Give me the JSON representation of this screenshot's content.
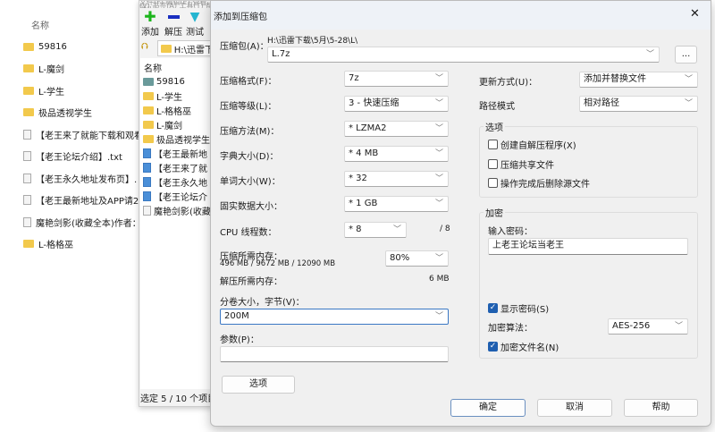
{
  "explorer": {
    "column_header": "名称",
    "items": [
      {
        "name": "59816",
        "type": "folder"
      },
      {
        "name": "L-魔剑",
        "type": "folder"
      },
      {
        "name": "L-学生",
        "type": "folder"
      },
      {
        "name": "极品透视学生",
        "type": "folder"
      },
      {
        "name": "【老王来了就能下载和观看",
        "type": "file"
      },
      {
        "name": "【老王论坛介绍】.txt",
        "type": "file"
      },
      {
        "name": "【老王永久地址发布页】.",
        "type": "file"
      },
      {
        "name": "【老王最新地址及APP请2",
        "type": "file"
      },
      {
        "name": "魔艳剑影(收藏全本)作者：",
        "type": "file"
      },
      {
        "name": "L-格格巫",
        "type": "folder"
      }
    ]
  },
  "sevenzip": {
    "menu": "文件(F)  编辑(E)  查看(V)  书签(A)  工具(T)  帮助(H)",
    "toolbar": {
      "add": "添加",
      "extract": "解压",
      "test": "测试"
    },
    "address": "H:\\迅雷下",
    "column_header": "名称",
    "items": [
      {
        "name": "59816",
        "type": "folder-teal"
      },
      {
        "name": "L-学生",
        "type": "folder"
      },
      {
        "name": "L-格格巫",
        "type": "folder"
      },
      {
        "name": "L-魔剑",
        "type": "folder"
      },
      {
        "name": "极品透视学生",
        "type": "folder"
      },
      {
        "name": "【老王最新地",
        "type": "blue"
      },
      {
        "name": "【老王来了就",
        "type": "blue"
      },
      {
        "name": "【老王永久地",
        "type": "blue"
      },
      {
        "name": "【老王论坛介",
        "type": "blue"
      },
      {
        "name": "魔艳剑影(收藏",
        "type": "file"
      }
    ],
    "status": "选定 5 / 10 个项目"
  },
  "dialog": {
    "title": "添加到压缩包",
    "close": "✕",
    "archive_label": "压缩包(A)：",
    "archive_dir": "H:\\迅雷下载\\5月\\5-28\\L\\",
    "archive_name": "L.7z",
    "browse": "...",
    "format_label": "压缩格式(F)：",
    "format": "7z",
    "level_label": "压缩等级(L)：",
    "level": "3 - 快速压缩",
    "method_label": "压缩方法(M)：",
    "method": "* LZMA2",
    "dict_label": "字典大小(D)：",
    "dict": "* 4 MB",
    "word_label": "单词大小(W)：",
    "word": "* 32",
    "solid_label": "固实数据大小：",
    "solid": "* 1 GB",
    "cpu_label": "CPU 线程数：",
    "cpu": "* 8",
    "cpu_max": "/ 8",
    "mem_label": "压缩所需内存：",
    "mem_values": "496 MB / 9672 MB / 12090 MB",
    "mem_percent": "80%",
    "decomp_label": "解压所需内存：",
    "decomp_value": "6 MB",
    "split_label": "分卷大小，字节(V)：",
    "split_value": "200M",
    "params_label": "参数(P)：",
    "params_value": "",
    "options_button": "选项",
    "update_label": "更新方式(U)：",
    "update_value": "添加并替换文件",
    "path_label": "路径模式",
    "path_value": "相对路径",
    "options_group": "选项",
    "opt_sfx": "创建自解压程序(X)",
    "opt_shared": "压缩共享文件",
    "opt_delete": "操作完成后删除源文件",
    "enc_group": "加密",
    "pwd_label": "输入密码：",
    "pwd_value": "上老王论坛当老王",
    "show_pwd": "显示密码(S)",
    "enc_method_label": "加密算法：",
    "enc_method": "AES-256",
    "enc_names": "加密文件名(N)",
    "ok": "确定",
    "cancel": "取消",
    "help": "帮助"
  }
}
